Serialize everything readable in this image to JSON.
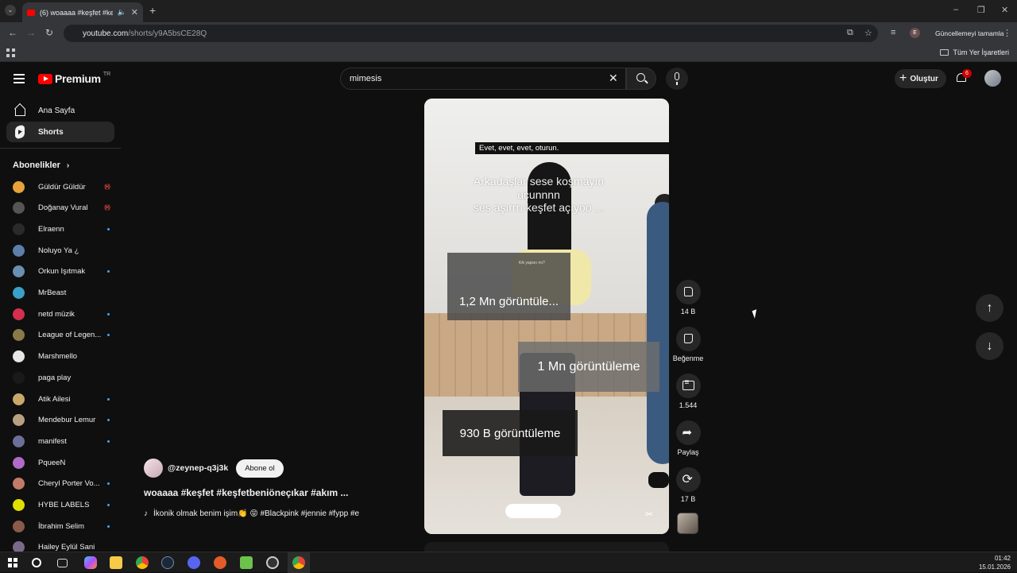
{
  "browser": {
    "tab_title": "(6) woaaaa #keşfet #keşfetb",
    "url_host": "youtube.com",
    "url_path": "/shorts/y9A5bsCE28Q",
    "update_label": "Güncellemeyi tamamla",
    "profile_letter": "E",
    "bookmarks_label": "Tüm Yer İşaretleri"
  },
  "header": {
    "logo_text": "Premium",
    "logo_region": "TR",
    "search_value": "mimesis",
    "create_label": "Oluştur",
    "notification_count": "6"
  },
  "sidebar": {
    "nav": [
      {
        "label": "Ana Sayfa"
      },
      {
        "label": "Shorts"
      }
    ],
    "subs_title": "Abonelikler",
    "subscriptions": [
      {
        "name": "Güldür Güldür",
        "status": "live",
        "color": "#e8a23a"
      },
      {
        "name": "Doğanay Vural",
        "status": "live",
        "color": "#555"
      },
      {
        "name": "Elraenn",
        "status": "dot",
        "color": "#2a2a2a"
      },
      {
        "name": "Noluyo Ya ¿",
        "status": "none",
        "color": "#5b7fa8"
      },
      {
        "name": "Orkun Işıtmak",
        "status": "dot",
        "color": "#6a8fb0"
      },
      {
        "name": "MrBeast",
        "status": "none",
        "color": "#3aa0c8"
      },
      {
        "name": "netd müzik",
        "status": "dot",
        "color": "#d62f4e"
      },
      {
        "name": "League of Legen...",
        "status": "dot",
        "color": "#8a7a4a"
      },
      {
        "name": "Marshmello",
        "status": "none",
        "color": "#e6e6e6"
      },
      {
        "name": "paga play",
        "status": "none",
        "color": "#1a1a1a"
      },
      {
        "name": "Atik Ailesi",
        "status": "dot",
        "color": "#c9a96a"
      },
      {
        "name": "Mendebur Lemur",
        "status": "dot",
        "color": "#b8a082"
      },
      {
        "name": "manifest",
        "status": "dot",
        "color": "#6b6f9a"
      },
      {
        "name": "PqueeN",
        "status": "none",
        "color": "#b06ac8"
      },
      {
        "name": "Cheryl Porter Vo...",
        "status": "dot",
        "color": "#c27a6a"
      },
      {
        "name": "HYBE LABELS",
        "status": "dot",
        "color": "#e0e000"
      },
      {
        "name": "İbrahim Selim",
        "status": "dot",
        "color": "#8a5a4a"
      },
      {
        "name": "Hailey Eylül Sani",
        "status": "none",
        "color": "#7a6a8a"
      }
    ]
  },
  "video": {
    "caption_top": "Evet, evet, evet, oturun.",
    "overlay_line1": "Arkadaşlar sese koşmayın",
    "overlay_line2": "uçunnnn",
    "overlay_line3": "ses aşırrrı keşfet açıyoo ...",
    "box1_small": "Kik yapsın mı?",
    "box1": "1,2 Mn görüntüle...",
    "box2": "1 Mn görüntüleme",
    "box3": "930 B görüntüleme"
  },
  "actions": {
    "likes": "14 B",
    "dislike_label": "Beğenme",
    "comments": "1.544",
    "share_label": "Paylaş",
    "remix_count": "17 B"
  },
  "channel": {
    "handle": "@zeynep-q3j3k",
    "subscribe_label": "Abone ol",
    "title": "woaaaa #keşfet #keşfetbeniöneçıkar #akım ...",
    "music": "İkonik olmak benim işim👏 😝 #Blackpink #jennie #fypp #e"
  },
  "taskbar": {
    "time": "01:42",
    "date": "15.01.2026"
  }
}
